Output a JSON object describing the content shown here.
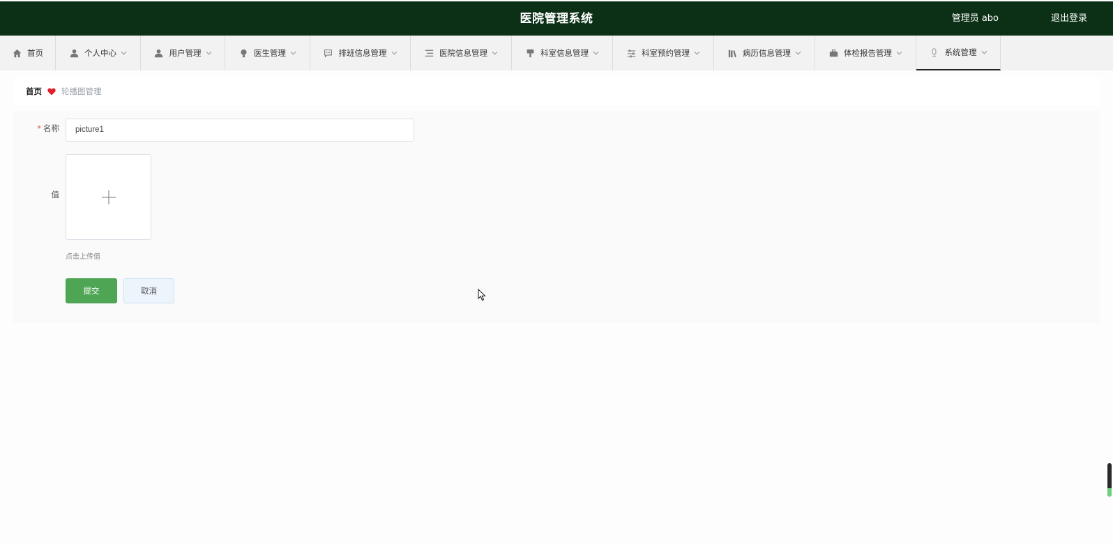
{
  "header": {
    "title": "医院管理系统",
    "user": "管理员 abo",
    "logout_label": "退出登录"
  },
  "nav": {
    "items": [
      {
        "label": "首页",
        "icon": "home-icon",
        "has_dropdown": false
      },
      {
        "label": "个人中心",
        "icon": "user-icon",
        "has_dropdown": true
      },
      {
        "label": "用户管理",
        "icon": "user-icon",
        "has_dropdown": true
      },
      {
        "label": "医生管理",
        "icon": "bulb-icon",
        "has_dropdown": true
      },
      {
        "label": "排班信息管理",
        "icon": "chat-icon",
        "has_dropdown": true
      },
      {
        "label": "医院信息管理",
        "icon": "list-icon",
        "has_dropdown": true
      },
      {
        "label": "科室信息管理",
        "icon": "brush-icon",
        "has_dropdown": true
      },
      {
        "label": "科室预约管理",
        "icon": "sliders-icon",
        "has_dropdown": true
      },
      {
        "label": "病历信息管理",
        "icon": "books-icon",
        "has_dropdown": true
      },
      {
        "label": "体检报告管理",
        "icon": "briefcase-icon",
        "has_dropdown": true
      },
      {
        "label": "系统管理",
        "icon": "mic-icon",
        "has_dropdown": true,
        "active": true
      }
    ]
  },
  "breadcrumb": {
    "home": "首页",
    "current": "轮播图管理"
  },
  "form": {
    "name_label": "名称",
    "required_mark": "*",
    "name_value": "picture1",
    "value_label": "值",
    "upload_hint": "点击上传值",
    "submit_label": "提交",
    "cancel_label": "取消"
  },
  "colors": {
    "header_bg": "#0b3016",
    "submit_bg": "#4ea655",
    "cancel_bg": "#ecf4fc",
    "heart": "#e0202a"
  }
}
